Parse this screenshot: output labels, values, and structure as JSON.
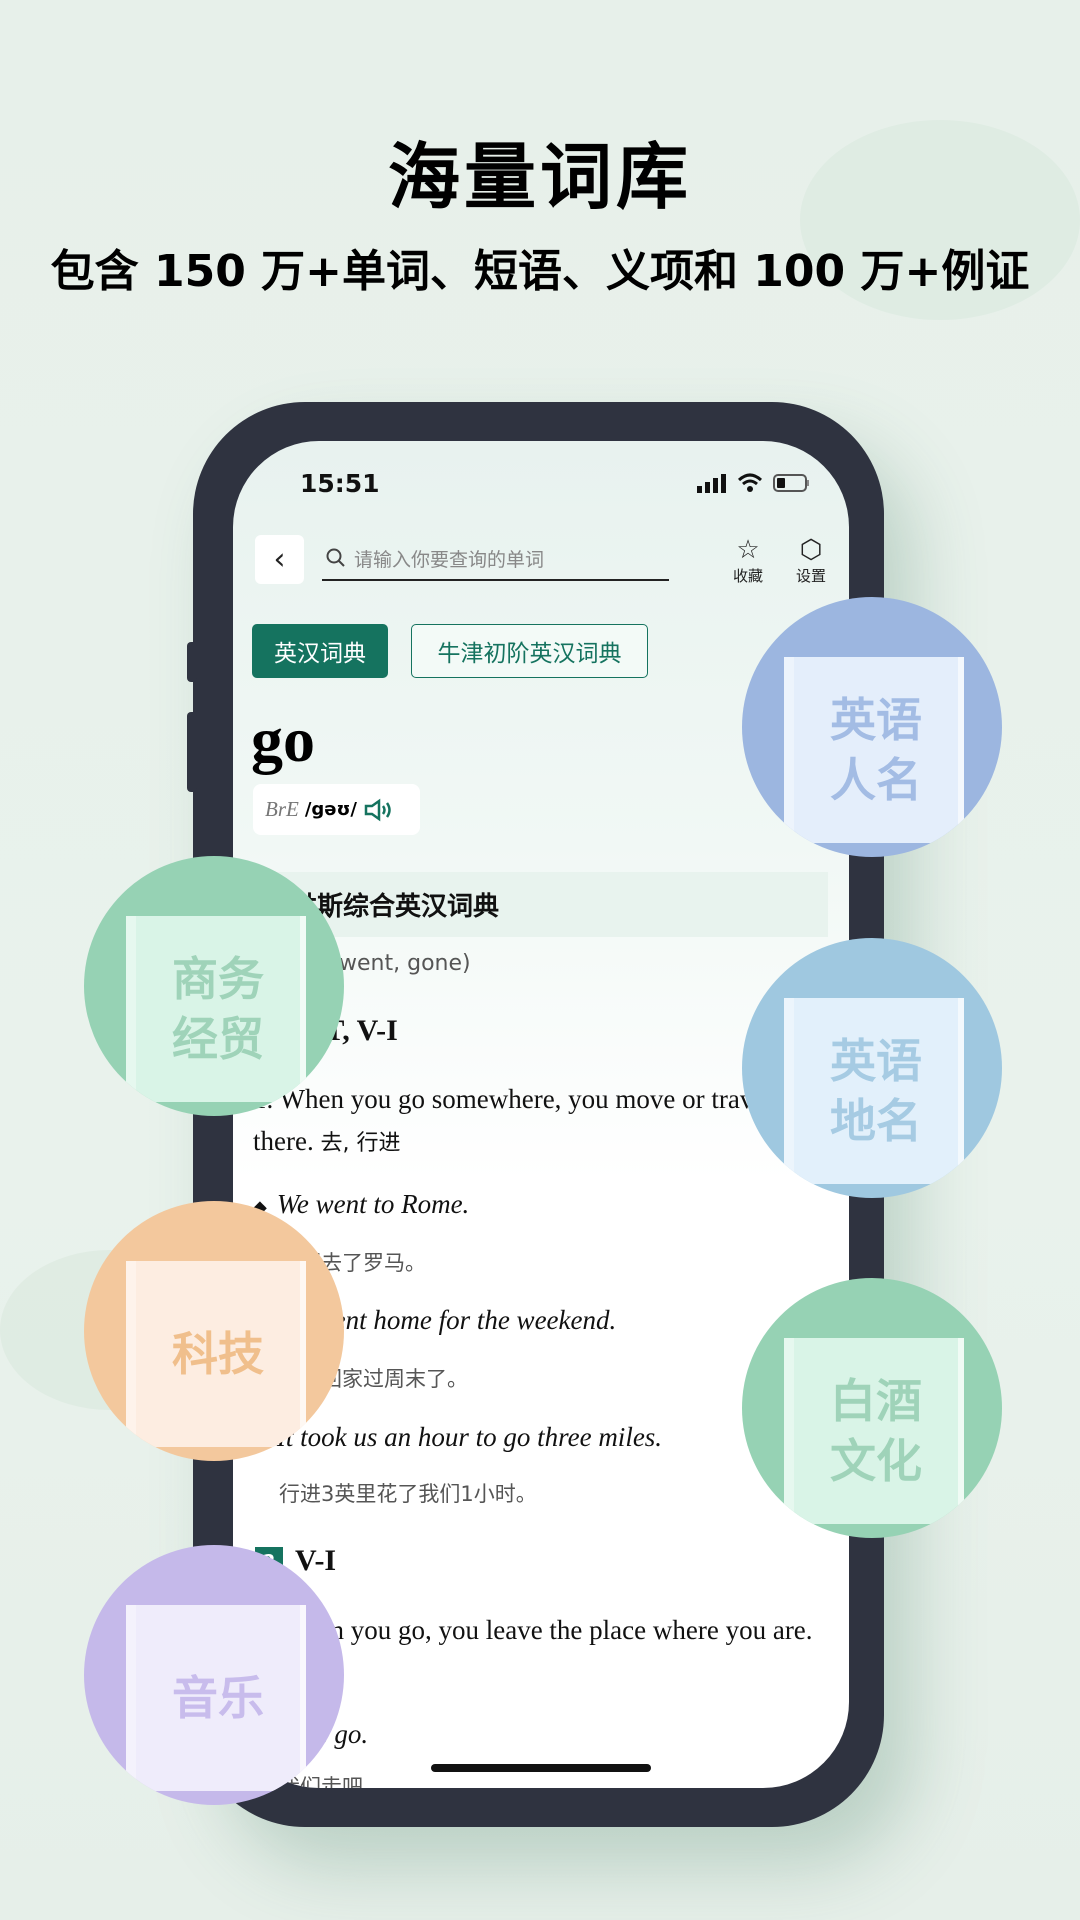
{
  "hero": {
    "title": "海量词库",
    "subtitle": "包含 150 万+单词、短语、义项和 100 万+例证"
  },
  "status_bar": {
    "time": "15:51",
    "icons": [
      "signal-icon",
      "wifi-icon",
      "battery-icon"
    ]
  },
  "header": {
    "back_icon": "chevron-left-icon",
    "search_placeholder": "请输入你要查询的单词",
    "favorite_label": "收藏",
    "settings_label": "设置"
  },
  "dict_tabs": [
    {
      "label": "英汉词典",
      "active": true
    },
    {
      "label": "牛津初阶英汉词典",
      "active": false
    }
  ],
  "entry": {
    "word": "go",
    "pron_label": "BrE",
    "ipa": "/gəʊ/",
    "dictionary": "柯林斯综合英汉词典",
    "forms": "(going, went, gone)",
    "senses": [
      {
        "number": "1",
        "pos": "V-T, V-I",
        "definition": "1. When you go somewhere, you move or travel there.",
        "definition_zh": "去, 行进",
        "examples": [
          {
            "en": "We went to Rome.",
            "zh": "我们去了罗马。"
          },
          {
            "en": "We went home for the weekend.",
            "zh": "我们回家过周末了。"
          },
          {
            "en": "It took us an hour to go three miles.",
            "zh": "行进3英里花了我们1小时。"
          }
        ]
      },
      {
        "number": "2",
        "pos": "V-I",
        "definition": "2. When you go, you leave the place where you are.",
        "definition_zh": "离开",
        "examples": [
          {
            "en": "Let's go.",
            "zh": "我们走吧。"
          }
        ]
      }
    ]
  },
  "categories": [
    {
      "label": "英语人名",
      "ring": "#9cb6e0",
      "book": "#e4eefb",
      "text": "#a3bce4"
    },
    {
      "label": "商务经贸",
      "ring": "#96d2b4",
      "book": "#d9f4e7",
      "text": "#9fd3b9"
    },
    {
      "label": "英语地名",
      "ring": "#9fc8e0",
      "book": "#e2f0fb",
      "text": "#a6cbe3"
    },
    {
      "label": "科技",
      "ring": "#f3c89d",
      "book": "#fdede1",
      "text": "#f0bf8c"
    },
    {
      "label": "白酒文化",
      "ring": "#96d2b4",
      "book": "#d9f4e7",
      "text": "#9fd3b9"
    },
    {
      "label": "音乐",
      "ring": "#c5b9ea",
      "book": "#efecfb",
      "text": "#c8bcec"
    }
  ],
  "colors": {
    "accent": "#15735f",
    "background": "#e7f0ea",
    "phone_frame": "#2f3340"
  }
}
